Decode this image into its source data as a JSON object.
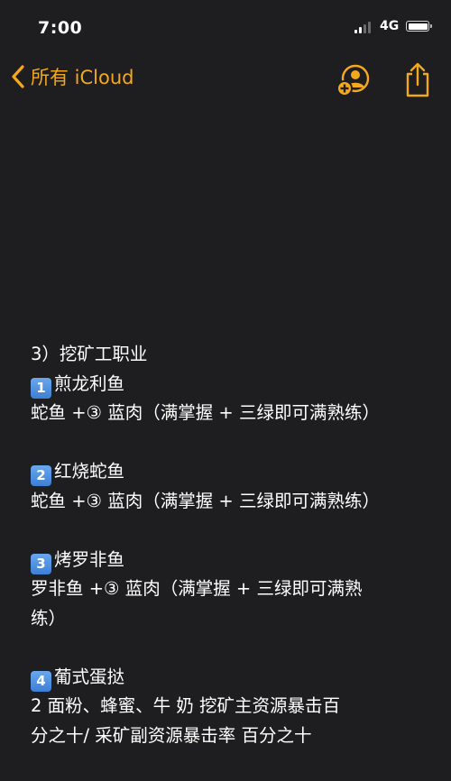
{
  "status_bar": {
    "time": "7:00",
    "network": "4G"
  },
  "nav": {
    "back_label": "所有 iCloud",
    "accent_color": "#f4a81d",
    "icons": [
      "chevron-left-icon",
      "add-person-icon",
      "share-icon"
    ]
  },
  "note": {
    "section_title": "3）挖矿工职业",
    "items": [
      {
        "badge": "1",
        "title": "煎龙利鱼",
        "lines": [
          "蛇鱼 +③ 蓝肉（满掌握 + 三绿即可满熟练）"
        ]
      },
      {
        "badge": "2",
        "title": "红烧蛇鱼",
        "lines": [
          "蛇鱼 +③ 蓝肉（满掌握 + 三绿即可满熟练）"
        ]
      },
      {
        "badge": "3",
        "title": "烤罗非鱼",
        "lines": [
          "罗非鱼 +③ 蓝肉（满掌握 + 三绿即可满熟",
          "练）"
        ]
      },
      {
        "badge": "4",
        "title": "葡式蛋挞",
        "lines": [
          "2 面粉、蜂蜜、牛 奶 挖矿主资源暴击百",
          "分之十/ 采矿副资源暴击率 百分之十"
        ]
      }
    ]
  }
}
